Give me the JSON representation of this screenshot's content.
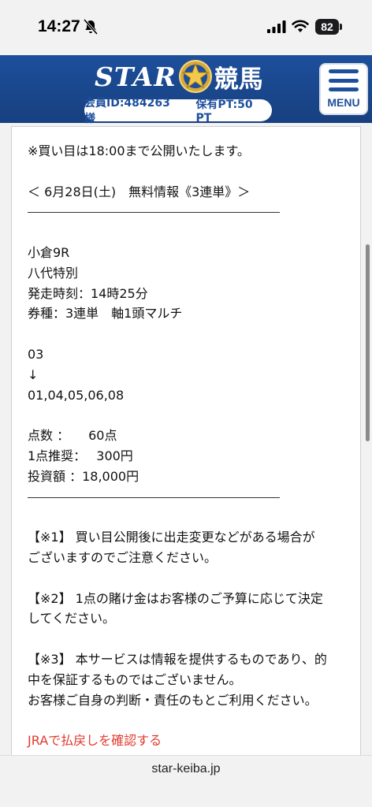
{
  "status_bar": {
    "time": "14:27",
    "battery": "82"
  },
  "header": {
    "logo_text": "STAR",
    "logo_kanji": "競馬",
    "member_id": "会員ID:484263 様",
    "points": "保有PT:50 PT",
    "menu_label": "MENU",
    "brand_color": "#1d4f9c"
  },
  "content": {
    "notice": "※買い目は18:00まで公開いたします。",
    "heading": "＜ 6月28日(土)　無料情報《3連単》＞",
    "race_venue": "小倉9R",
    "race_name": "八代特別",
    "start_time": "発走時刻：14時25分",
    "ticket_type": "券種：3連単　軸1頭マルチ",
    "axis_number": "03",
    "arrow": "↓",
    "partner_numbers": "01,04,05,06,08",
    "points_count": "点数 ：　　60点",
    "per_point": "1点推奨：　 300円",
    "total_investment": "投資額 ：18,000円",
    "note1_line1": "【※1】 買い目公開後に出走変更などがある場合が",
    "note1_line2": "ございますのでご注意ください。",
    "note2_line1": "【※2】 1点の賭け金はお客様のご予算に応じて決定",
    "note2_line2": "してください。",
    "note3_line1": "【※3】 本サービスは情報を提供するものであり、的",
    "note3_line2": "中を保証するものではございません。",
    "note3_line3": "お客様ご自身の判断・責任のもとご利用ください。",
    "jra_link": "JRAで払戻しを確認する",
    "link_color": "#e0392b"
  },
  "browser": {
    "url": "star-keiba.jp"
  }
}
